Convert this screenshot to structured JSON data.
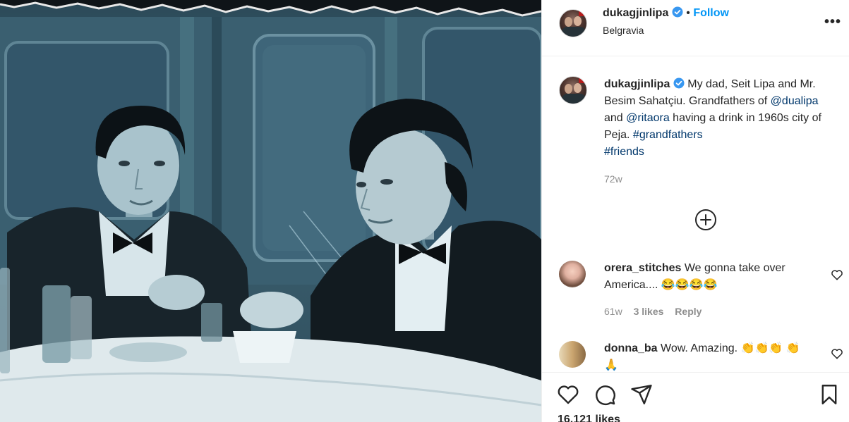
{
  "post": {
    "username": "dukagjinlipa",
    "follow_label": "Follow",
    "separator": "•",
    "location": "Belgravia",
    "more_label": "•••"
  },
  "caption": {
    "username": "dukagjinlipa",
    "text_1": " My dad, Seit Lipa and Mr. Besim Sahatçiu. Grandfathers of ",
    "mention_1": "@dualipa",
    "text_2": " and ",
    "mention_2": "@ritaora",
    "text_3": " having a drink in 1960s city of Peja. ",
    "tag_1": "#grandfathers",
    "tag_2": "#friends",
    "time": "72w"
  },
  "comments": [
    {
      "username": "orera_stitches",
      "text": " We gonna take over America.... 😂😂😂😂",
      "time": "61w",
      "likes": "3 likes",
      "reply": "Reply"
    },
    {
      "username": "donna_ba",
      "text": " Wow. Amazing. 👏👏👏 👏🙏"
    }
  ],
  "likes_count": "16,121 likes",
  "icons": {
    "verified": "verified-badge-icon",
    "more": "more-options-icon",
    "load_more": "plus-circle-icon",
    "heart": "heart-icon",
    "comment": "comment-bubble-icon",
    "share": "paper-plane-icon",
    "save": "bookmark-icon"
  },
  "colors": {
    "follow": "#0095f6",
    "link": "#00376b",
    "muted": "#8e8e8e",
    "text": "#262626"
  }
}
